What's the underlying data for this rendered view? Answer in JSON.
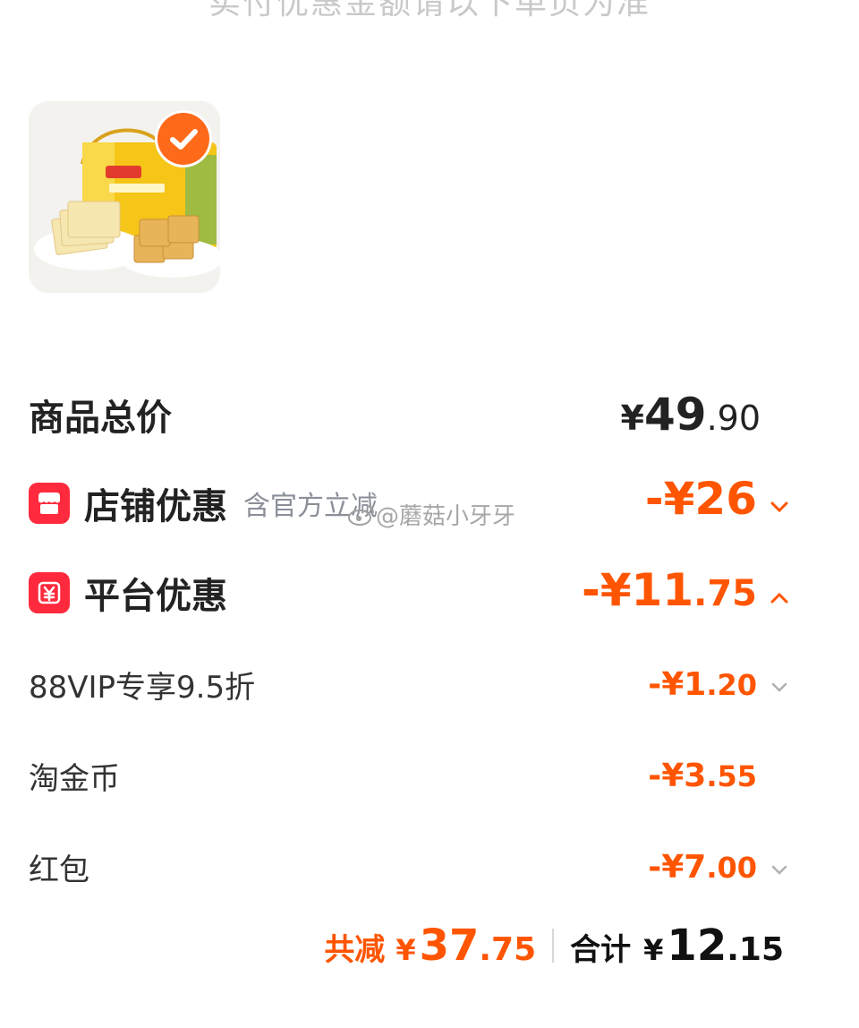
{
  "top_banner_text": "实付优惠金额请以下单页为准",
  "product": {
    "check_icon": "check-icon",
    "accent": "#ff6a1a"
  },
  "price_total": {
    "label": "商品总价",
    "currency": "¥",
    "int": "49",
    "dec": ".90"
  },
  "shop_discount": {
    "label": "店铺优惠",
    "note": "含官方立减",
    "amount": "-¥26",
    "icon": "shop-icon",
    "chevron": "chevron-down-icon"
  },
  "platform_discount": {
    "label": "平台优惠",
    "int": "-¥11",
    "dec": ".75",
    "icon": "yuan-tag-icon",
    "chevron": "chevron-up-icon"
  },
  "items": [
    {
      "label": "88VIP专享9.5折",
      "int": "-¥1",
      "dec": ".20",
      "chevron": "chevron-down-icon"
    },
    {
      "label": "淘金币",
      "int": "-¥3",
      "dec": ".55",
      "chevron": ""
    },
    {
      "label": "红包",
      "int": "-¥7",
      "dec": ".00",
      "chevron": "chevron-down-icon"
    }
  ],
  "watermark": "@蘑菇小牙牙",
  "summary": {
    "save_label": "共减",
    "save_currency": "¥",
    "save_int": "37",
    "save_dec": ".75",
    "total_label": "合计",
    "total_currency": "¥",
    "total_int": "12",
    "total_dec": ".15"
  },
  "colors": {
    "discount": "#ff5500",
    "icon_red": "#ff2a3d",
    "text_dark": "#222222",
    "text_gray": "#8a8f99"
  }
}
